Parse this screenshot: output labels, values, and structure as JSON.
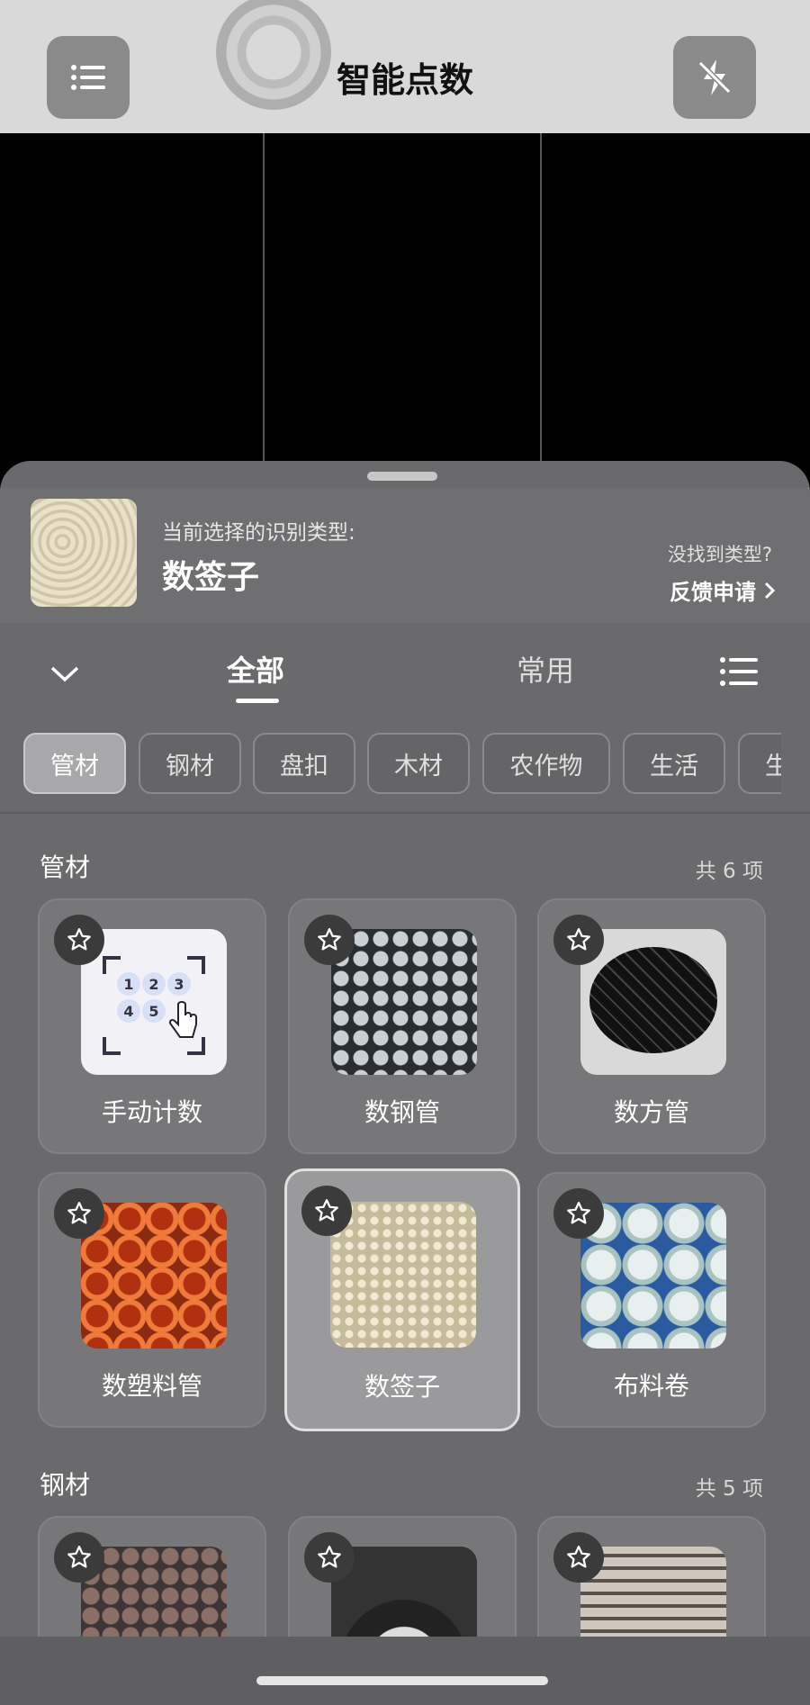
{
  "header": {
    "title": "智能点数",
    "menu_icon": "list-icon",
    "flash_icon": "flash-off-icon"
  },
  "current_selection": {
    "caption": "当前选择的识别类型:",
    "value": "数签子",
    "not_found": "没找到类型?",
    "feedback": "反馈申请"
  },
  "tabs": [
    {
      "label": "全部",
      "active": true
    },
    {
      "label": "常用",
      "active": false
    }
  ],
  "chips": [
    "管材",
    "钢材",
    "盘扣",
    "木材",
    "农作物",
    "生活",
    "生"
  ],
  "sections": [
    {
      "title": "管材",
      "count": "共 6 项",
      "items": [
        "手动计数",
        "数钢管",
        "数方管",
        "数塑料管",
        "数签子",
        "布料卷"
      ]
    },
    {
      "title": "钢材",
      "count": "共 5 项",
      "items": [
        "",
        "",
        ""
      ]
    }
  ],
  "manual_digits": [
    "1",
    "2",
    "3",
    "4",
    "5"
  ],
  "colors": {
    "sheet_bg": "#6a6a6c",
    "card_bg": "#777779",
    "active_chip": "#a8a8aa"
  }
}
